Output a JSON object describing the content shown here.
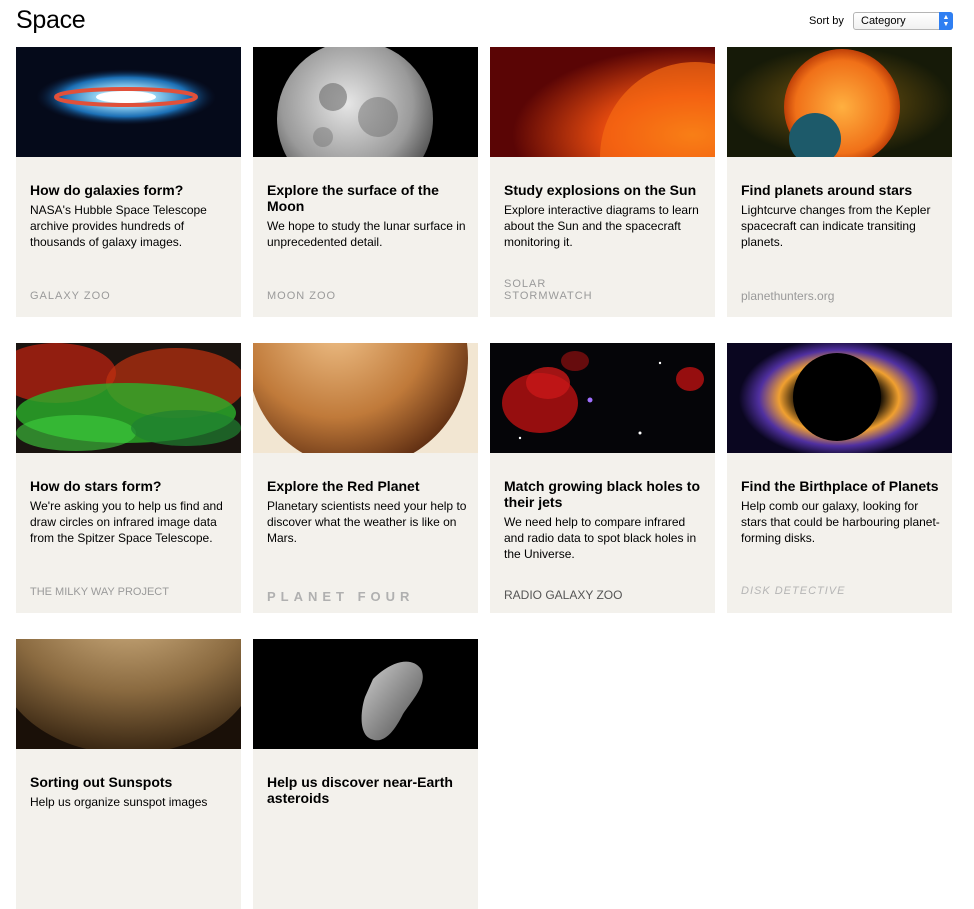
{
  "page": {
    "title": "Space"
  },
  "sort": {
    "label": "Sort by",
    "selected": "Category"
  },
  "cards": [
    {
      "title": "How do galaxies form?",
      "desc": "NASA's Hubble Space Telescope archive provides hundreds of thousands of galaxy images.",
      "logo": "GALAXY ZOO"
    },
    {
      "title": "Explore the surface of the Moon",
      "desc": "We hope to study the lunar surface in unprecedented detail.",
      "logo": "MOON ZOO"
    },
    {
      "title": "Study explosions on the Sun",
      "desc": "Explore interactive diagrams to learn about the Sun and the spacecraft monitoring it.",
      "logo": "SOLAR STORMWATCH"
    },
    {
      "title": "Find planets around stars",
      "desc": "Lightcurve changes from the Kepler spacecraft can indicate transiting planets.",
      "logo": "planethunters.org"
    },
    {
      "title": "How do stars form?",
      "desc": "We're asking you to help us find and draw circles on infrared image data from the Spitzer Space Telescope.",
      "logo": "THE MILKY WAY PROJECT"
    },
    {
      "title": "Explore the Red Planet",
      "desc": "Planetary scientists need your help to discover what the weather is like on Mars.",
      "logo": "PLANET FOUR"
    },
    {
      "title": "Match growing black holes to their jets",
      "desc": "We need help to compare infrared and radio data to spot black holes in the Universe.",
      "logo": "RADIO GALAXY ZOO"
    },
    {
      "title": "Find the Birthplace of Planets",
      "desc": "Help comb our galaxy, looking for stars that could be harbouring planet-forming disks.",
      "logo": "DISK DETECTIVE"
    },
    {
      "title": "Sorting out Sunspots",
      "desc": "Help us organize sunspot images",
      "logo": ""
    },
    {
      "title": "Help us discover near-Earth asteroids",
      "desc": "",
      "logo": ""
    }
  ]
}
